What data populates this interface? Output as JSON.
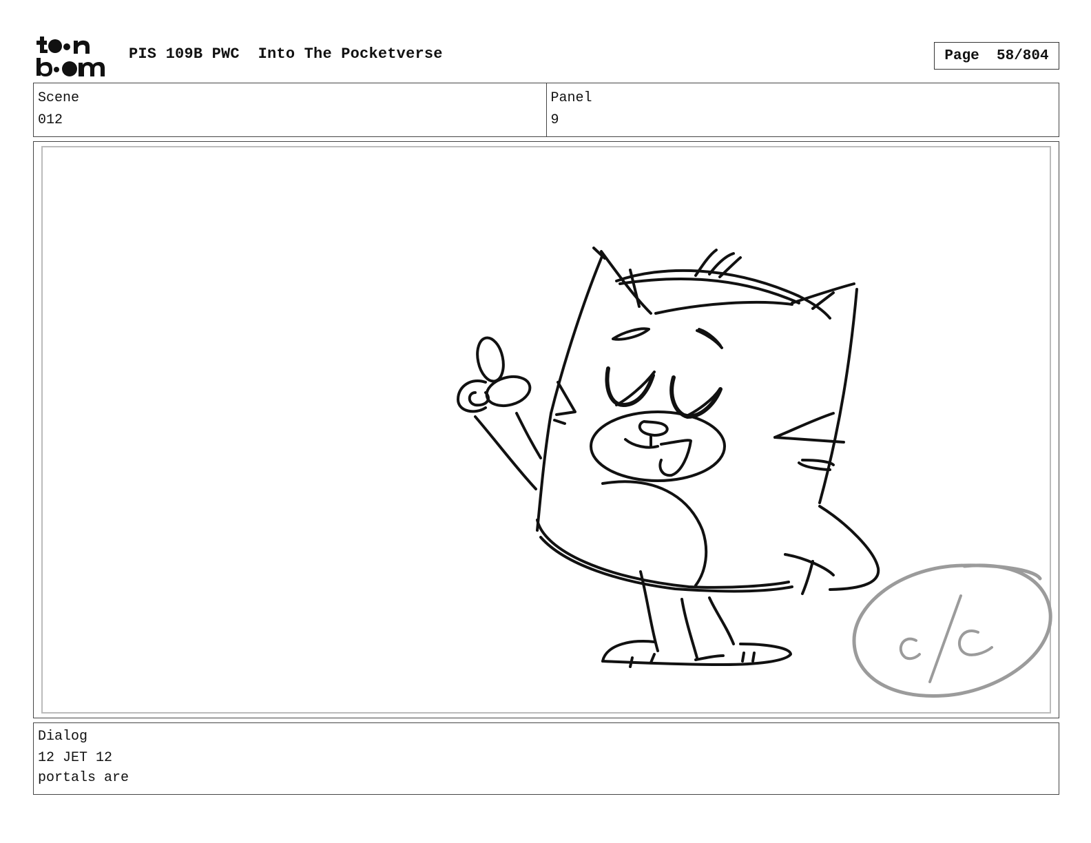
{
  "header": {
    "logo_alt": "toon boom",
    "title": "PIS 109B PWC  Into The Pocketverse",
    "page_label": "Page",
    "page_value": "58/804"
  },
  "meta": {
    "scene_label": "Scene",
    "scene_value": "012",
    "panel_label": "Panel",
    "panel_value": "9"
  },
  "panel": {
    "stamp_text": "c/c"
  },
  "dialog": {
    "label": "Dialog",
    "lines": [
      "12 JET 12",
      "portals are"
    ]
  }
}
